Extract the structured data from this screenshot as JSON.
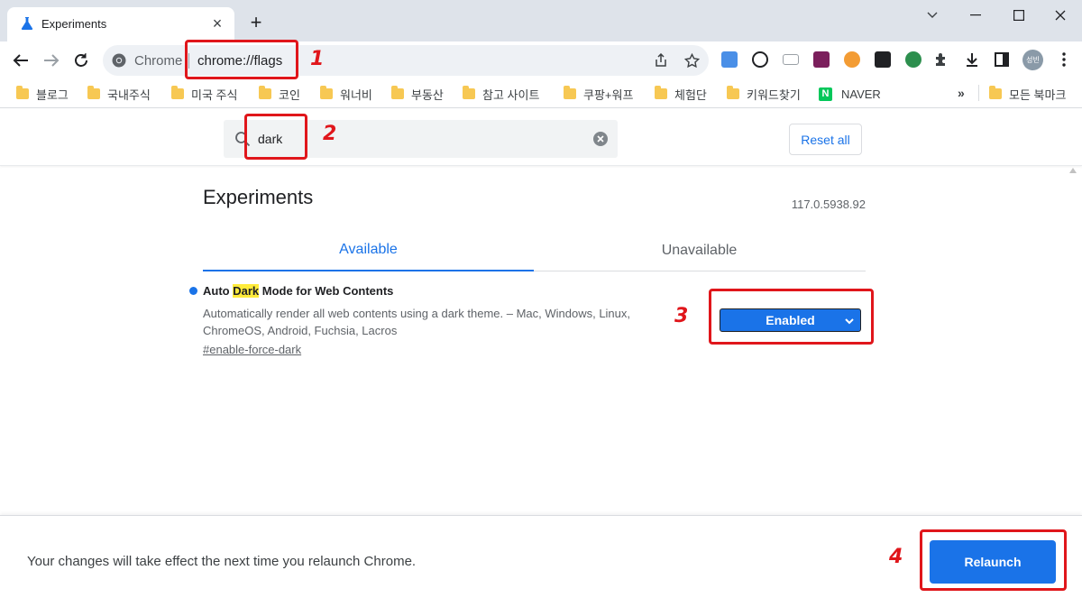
{
  "browser": {
    "tab_title": "Experiments",
    "omnibox": {
      "site_label": "Chrome",
      "url": "chrome://flags"
    },
    "profile_initials": "성빈"
  },
  "bookmarks": [
    {
      "label": "블로그"
    },
    {
      "label": "국내주식"
    },
    {
      "label": "미국 주식"
    },
    {
      "label": "코인"
    },
    {
      "label": "워너비"
    },
    {
      "label": "부동산"
    },
    {
      "label": "참고 사이트"
    },
    {
      "label": "쿠팡+워프"
    },
    {
      "label": "체험단"
    },
    {
      "label": "키워드찾기"
    },
    {
      "label": "NAVER",
      "icon": "N"
    }
  ],
  "bookmarks_overflow": {
    "chevron": "»",
    "other_label": "모든 북마크"
  },
  "flags_page": {
    "search_value": "dark",
    "reset_label": "Reset all",
    "title": "Experiments",
    "version": "117.0.5938.92",
    "tabs": [
      {
        "label": "Available"
      },
      {
        "label": "Unavailable"
      }
    ],
    "flag": {
      "name_prefix": "Auto ",
      "name_highlight": "Dark",
      "name_suffix": " Mode for Web Contents",
      "description": "Automatically render all web contents using a dark theme. – Mac, Windows, Linux, ChromeOS, Android, Fuchsia, Lacros",
      "link": "#enable-force-dark",
      "selected_value": "Enabled"
    },
    "footer_message": "Your changes will take effect the next time you relaunch Chrome.",
    "relaunch_label": "Relaunch"
  },
  "annotations": [
    "1",
    "2",
    "3",
    "4"
  ],
  "colors": {
    "accent": "#1a73e8",
    "annotation": "#e0161b",
    "highlight": "#ffeb3b"
  }
}
